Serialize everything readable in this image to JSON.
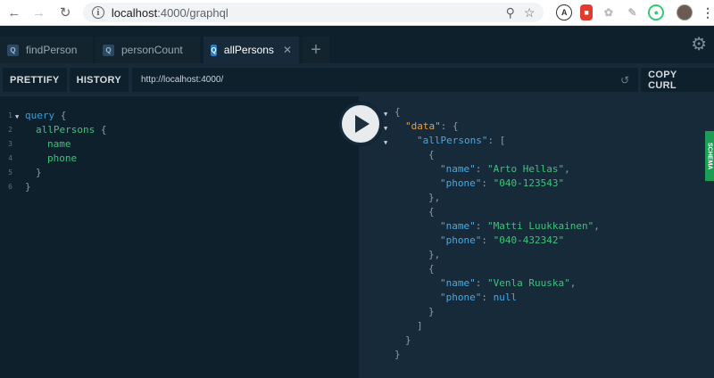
{
  "browser": {
    "url_host": "localhost",
    "url_path": ":4000/graphql"
  },
  "tabs": [
    {
      "icon": "Q",
      "label": "findPerson"
    },
    {
      "icon": "Q",
      "label": "personCount"
    },
    {
      "icon": "Q",
      "label": "allPersons",
      "close": "✕"
    }
  ],
  "toolbar": {
    "prettify_label": "PRETTIFY",
    "history_label": "HISTORY",
    "endpoint_value": "http://localhost:4000/",
    "copy_curl_label": "COPY CURL"
  },
  "query_editor": {
    "line_numbers": [
      "1",
      "2",
      "3",
      "4",
      "5",
      "6"
    ],
    "keyword": "query",
    "root_field": "allPersons",
    "fields": [
      "name",
      "phone"
    ]
  },
  "result": {
    "data_key": "\"data\"",
    "list_key": "\"allPersons\"",
    "persons": [
      {
        "name_key": "\"name\"",
        "name_value": "\"Arto Hellas\"",
        "phone_key": "\"phone\"",
        "phone_value": "\"040-123543\""
      },
      {
        "name_key": "\"name\"",
        "name_value": "\"Matti Luukkainen\"",
        "phone_key": "\"phone\"",
        "phone_value": "\"040-432342\""
      },
      {
        "name_key": "\"name\"",
        "name_value": "\"Venla Ruuska\"",
        "phone_key": "\"phone\"",
        "phone_value": "null"
      }
    ]
  },
  "schema_tab_label": "SCHEMA",
  "icons": {
    "back": "arrow-left-icon",
    "forward": "arrow-right-icon",
    "reload": "reload-icon",
    "info": "info-icon",
    "zoom": "zoom-icon",
    "star": "star-icon",
    "settings": "gear-icon",
    "run": "play-icon",
    "add_tab": "plus-icon",
    "history": "history-icon"
  },
  "colors": {
    "accent": "#2e7bbf",
    "schema_green": "#1a9e54",
    "field_green": "#3ec27b",
    "data_orange": "#e5a23c"
  }
}
